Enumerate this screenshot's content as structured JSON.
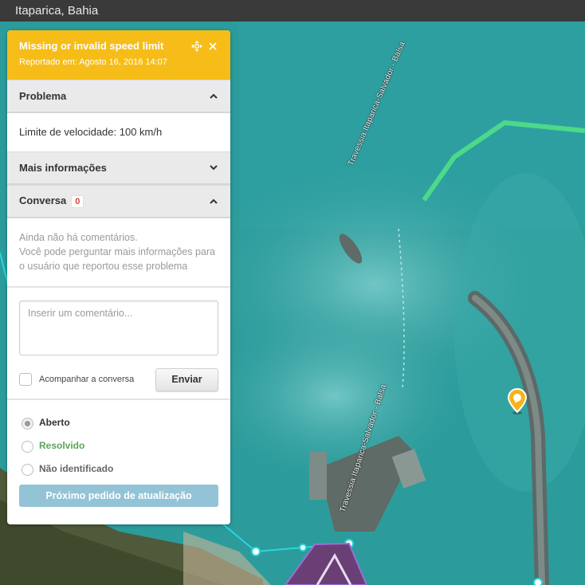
{
  "topbar": {
    "location": "Itaparica, Bahia"
  },
  "map": {
    "street_labels": [
      "Travessia Itaparica-Salvador - Balsa",
      "Travessia Itaparica-Salvador - Balsa"
    ],
    "marker_icon": "map-pin-icon",
    "colors": {
      "water": "#2a9a9a",
      "route_green": "#4cd98a",
      "road_cyan": "#27d6e0",
      "area_purple": "#9b6fd6"
    }
  },
  "panel": {
    "title": "Missing or invalid speed limit",
    "reported": "Reportado em: Agosto 16, 2016 14:07",
    "icons": {
      "move": "move-icon",
      "close": "close-icon"
    },
    "problem": {
      "label": "Problema",
      "speed_text": "Limite de velocidade: 100 km/h"
    },
    "more_info": {
      "label": "Mais informações"
    },
    "conversation": {
      "label": "Conversa",
      "count": "0",
      "no_comments": "Ainda não há comentários.",
      "hint": "Você pode perguntar mais informações para o usuário que reportou esse problema",
      "input_placeholder": "Inserir um comentário...",
      "input_value": "",
      "follow_label": "Acompanhar a conversa",
      "send_label": "Enviar"
    },
    "status": {
      "options": [
        "Aberto",
        "Resolvido",
        "Não identificado"
      ],
      "selected": "Aberto"
    },
    "next_button": "Próximo pedido de atualização",
    "colors": {
      "header": "#f6bd18",
      "resolved": "#5aa55a",
      "next_button": "#93c3d6"
    }
  }
}
